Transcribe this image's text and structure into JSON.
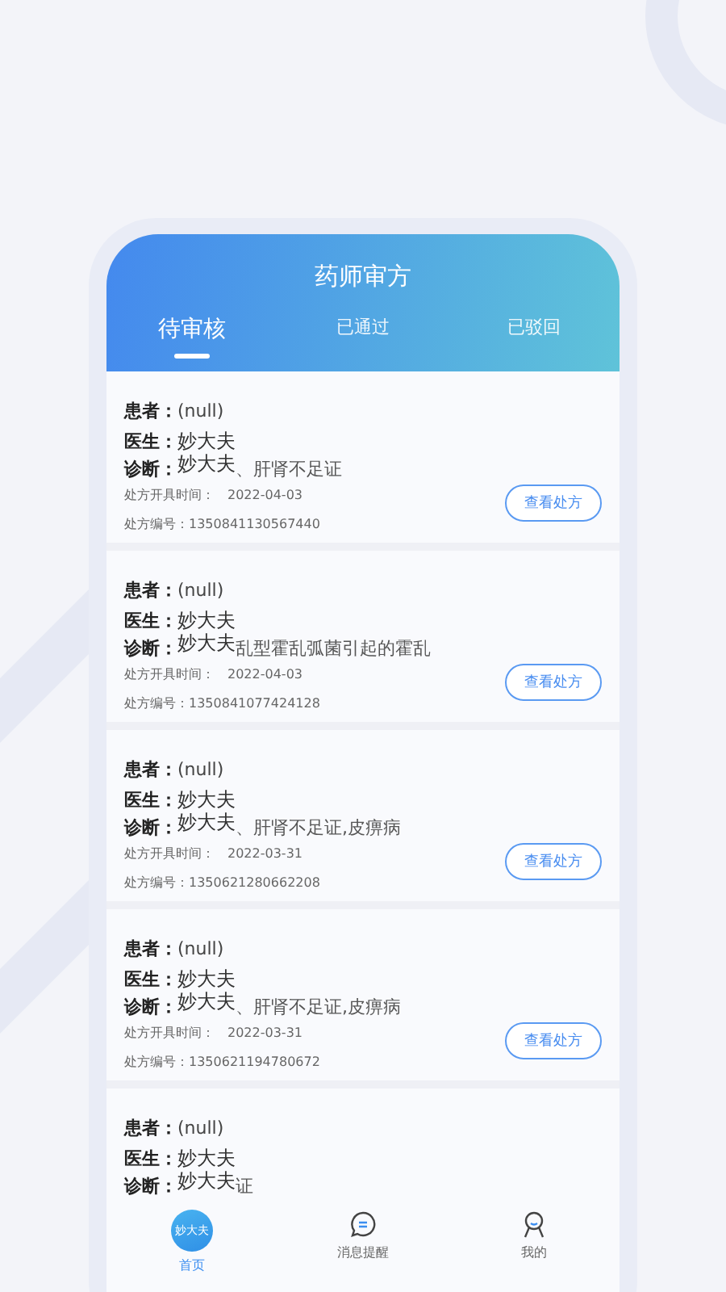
{
  "header": {
    "title": "药师审方"
  },
  "tabs": [
    {
      "label": "待审核",
      "selected": true
    },
    {
      "label": "已通过",
      "selected": false
    },
    {
      "label": "已驳回",
      "selected": false
    }
  ],
  "prescriptions": [
    {
      "patient_label": "患者：",
      "patient": "(null)",
      "doctor_label": "医生：",
      "doctor": "妙大夫",
      "diagnosis_label": "诊断：",
      "diagnosis_overlay": "妙大夫",
      "diagnosis": "、肝肾不足证",
      "time_label": "处方开具时间：",
      "time": "2022-04-03",
      "number_label": "处方编号：",
      "number": "1350841130567440",
      "button": "查看处方"
    },
    {
      "patient_label": "患者：",
      "patient": "(null)",
      "doctor_label": "医生：",
      "doctor": "妙大夫",
      "diagnosis_label": "诊断：",
      "diagnosis_overlay": "妙大夫",
      "diagnosis": "乱型霍乱弧菌引起的霍乱",
      "time_label": "处方开具时间：",
      "time": "2022-04-03",
      "number_label": "处方编号：",
      "number": "1350841077424128",
      "button": "查看处方"
    },
    {
      "patient_label": "患者：",
      "patient": "(null)",
      "doctor_label": "医生：",
      "doctor": "妙大夫",
      "diagnosis_label": "诊断：",
      "diagnosis_overlay": "妙大夫",
      "diagnosis": "、肝肾不足证,皮痹病",
      "time_label": "处方开具时间：",
      "time": "2022-03-31",
      "number_label": "处方编号：",
      "number": "1350621280662208",
      "button": "查看处方"
    },
    {
      "patient_label": "患者：",
      "patient": "(null)",
      "doctor_label": "医生：",
      "doctor": "妙大夫",
      "diagnosis_label": "诊断：",
      "diagnosis_overlay": "妙大夫",
      "diagnosis": "、肝肾不足证,皮痹病",
      "time_label": "处方开具时间：",
      "time": "2022-03-31",
      "number_label": "处方编号：",
      "number": "1350621194780672",
      "button": "查看处方"
    },
    {
      "patient_label": "患者：",
      "patient": "(null)",
      "doctor_label": "医生：",
      "doctor": "妙大夫",
      "diagnosis_label": "诊断：",
      "diagnosis_overlay": "妙大夫",
      "diagnosis": "证"
    }
  ],
  "bottom_nav": [
    {
      "kind": "logo",
      "logo_text": "妙大夫",
      "label": "首页",
      "selected": true
    },
    {
      "kind": "message",
      "label": "消息提醒",
      "selected": false
    },
    {
      "kind": "profile",
      "label": "我的",
      "selected": false
    }
  ]
}
